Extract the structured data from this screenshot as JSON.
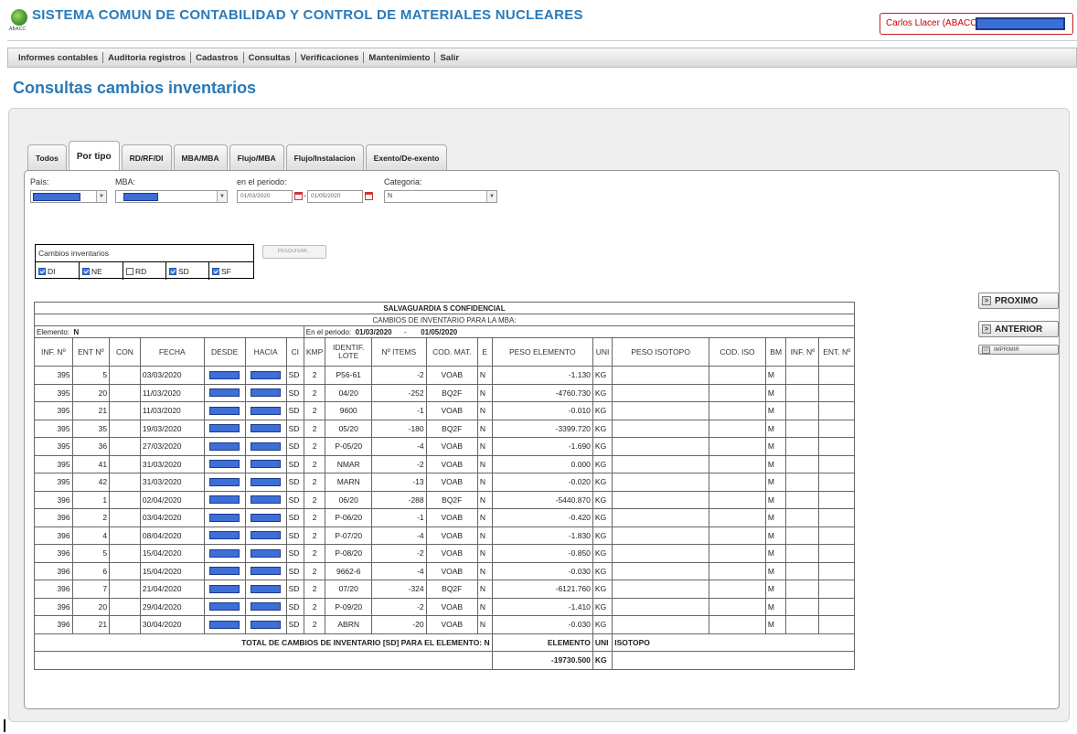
{
  "app": {
    "title": "SISTEMA COMUN DE CONTABILIDAD Y CONTROL DE MATERIALES NUCLEARES",
    "logo_text": "ABACC",
    "user_label": "Carlos Llacer (ABACC-"
  },
  "nav": {
    "items": [
      "Informes contables",
      "Auditoria registros",
      "Cadastros",
      "Consultas",
      "Verificaciones",
      "Mantenimiento",
      "Salir"
    ]
  },
  "page_title": "Consultas cambios inventarios",
  "tabs": [
    "Todos",
    "Por tipo",
    "RD/RF/DI",
    "MBA/MBA",
    "Flujo/MBA",
    "Flujo/Instalacion",
    "Exento/De-exento"
  ],
  "active_tab": "Por tipo",
  "filters": {
    "pais_label": "País:",
    "mba_label": "MBA:",
    "periodo_label": "en el periodo:",
    "categoria_label": "Categoria:",
    "date_from": "01/03/2020",
    "date_to": "01/05/2020",
    "categoria_value": "N",
    "pesquisar_label": "PESQUISAR..."
  },
  "cambios": {
    "title": "Cambios inventarios",
    "options": [
      {
        "label": "DI",
        "checked": true
      },
      {
        "label": "NE",
        "checked": true
      },
      {
        "label": "RD",
        "checked": false
      },
      {
        "label": "SD",
        "checked": true
      },
      {
        "label": "SF",
        "checked": true
      }
    ]
  },
  "buttons": {
    "proximo": "PROXIMO",
    "anterior": "ANTERIOR",
    "imprimir": "IMPRIMIR"
  },
  "report": {
    "title": "SALVAGUARDIA S CONFIDENCIAL",
    "subtitle": "CAMBIOS DE INVENTARIO PARA LA MBA:",
    "elemento_label": "Elemento:",
    "elemento_value": "N",
    "periodo_label": "En el periodo:",
    "periodo_from": "01/03/2020",
    "periodo_sep": "-",
    "periodo_to": "01/05/2020",
    "columns": [
      "INF. Nº",
      "ENT Nº",
      "CON",
      "FECHA",
      "DESDE",
      "HACIA",
      "CI",
      "KMP",
      "IDENTIF. LOTE",
      "Nº ITEMS",
      "COD. MAT.",
      "E",
      "PESO ELEMENTO",
      "UNI",
      "PESO ISOTOPO",
      "COD. ISO",
      "BM",
      "INF. Nº",
      "ENT. Nº"
    ],
    "rows": [
      {
        "inf": "395",
        "ent": "5",
        "fecha": "03/03/2020",
        "ci": "SD",
        "kmp": "2",
        "lote": "P56-61",
        "items": "-2",
        "codmat": "VOAB",
        "e": "N",
        "peso": "-1.130",
        "uni": "KG",
        "bm": "M"
      },
      {
        "inf": "395",
        "ent": "20",
        "fecha": "11/03/2020",
        "ci": "SD",
        "kmp": "2",
        "lote": "04/20",
        "items": "-252",
        "codmat": "BQ2F",
        "e": "N",
        "peso": "-4760.730",
        "uni": "KG",
        "bm": "M"
      },
      {
        "inf": "395",
        "ent": "21",
        "fecha": "11/03/2020",
        "ci": "SD",
        "kmp": "2",
        "lote": "9600",
        "items": "-1",
        "codmat": "VOAB",
        "e": "N",
        "peso": "-0.010",
        "uni": "KG",
        "bm": "M"
      },
      {
        "inf": "395",
        "ent": "35",
        "fecha": "19/03/2020",
        "ci": "SD",
        "kmp": "2",
        "lote": "05/20",
        "items": "-180",
        "codmat": "BQ2F",
        "e": "N",
        "peso": "-3399.720",
        "uni": "KG",
        "bm": "M"
      },
      {
        "inf": "395",
        "ent": "36",
        "fecha": "27/03/2020",
        "ci": "SD",
        "kmp": "2",
        "lote": "P-05/20",
        "items": "-4",
        "codmat": "VOAB",
        "e": "N",
        "peso": "-1.690",
        "uni": "KG",
        "bm": "M"
      },
      {
        "inf": "395",
        "ent": "41",
        "fecha": "31/03/2020",
        "ci": "SD",
        "kmp": "2",
        "lote": "NMAR",
        "items": "-2",
        "codmat": "VOAB",
        "e": "N",
        "peso": "0.000",
        "uni": "KG",
        "bm": "M"
      },
      {
        "inf": "395",
        "ent": "42",
        "fecha": "31/03/2020",
        "ci": "SD",
        "kmp": "2",
        "lote": "MARN",
        "items": "-13",
        "codmat": "VOAB",
        "e": "N",
        "peso": "-0.020",
        "uni": "KG",
        "bm": "M"
      },
      {
        "inf": "396",
        "ent": "1",
        "fecha": "02/04/2020",
        "ci": "SD",
        "kmp": "2",
        "lote": "06/20",
        "items": "-288",
        "codmat": "BQ2F",
        "e": "N",
        "peso": "-5440.870",
        "uni": "KG",
        "bm": "M"
      },
      {
        "inf": "396",
        "ent": "2",
        "fecha": "03/04/2020",
        "ci": "SD",
        "kmp": "2",
        "lote": "P-06/20",
        "items": "-1",
        "codmat": "VOAB",
        "e": "N",
        "peso": "-0.420",
        "uni": "KG",
        "bm": "M"
      },
      {
        "inf": "396",
        "ent": "4",
        "fecha": "08/04/2020",
        "ci": "SD",
        "kmp": "2",
        "lote": "P-07/20",
        "items": "-4",
        "codmat": "VOAB",
        "e": "N",
        "peso": "-1.830",
        "uni": "KG",
        "bm": "M"
      },
      {
        "inf": "396",
        "ent": "5",
        "fecha": "15/04/2020",
        "ci": "SD",
        "kmp": "2",
        "lote": "P-08/20",
        "items": "-2",
        "codmat": "VOAB",
        "e": "N",
        "peso": "-0.850",
        "uni": "KG",
        "bm": "M"
      },
      {
        "inf": "396",
        "ent": "6",
        "fecha": "15/04/2020",
        "ci": "SD",
        "kmp": "2",
        "lote": "9662-6",
        "items": "-4",
        "codmat": "VOAB",
        "e": "N",
        "peso": "-0.030",
        "uni": "KG",
        "bm": "M"
      },
      {
        "inf": "396",
        "ent": "7",
        "fecha": "21/04/2020",
        "ci": "SD",
        "kmp": "2",
        "lote": "07/20",
        "items": "-324",
        "codmat": "BQ2F",
        "e": "N",
        "peso": "-6121.760",
        "uni": "KG",
        "bm": "M"
      },
      {
        "inf": "396",
        "ent": "20",
        "fecha": "29/04/2020",
        "ci": "SD",
        "kmp": "2",
        "lote": "P-09/20",
        "items": "-2",
        "codmat": "VOAB",
        "e": "N",
        "peso": "-1.410",
        "uni": "KG",
        "bm": "M"
      },
      {
        "inf": "396",
        "ent": "21",
        "fecha": "30/04/2020",
        "ci": "SD",
        "kmp": "2",
        "lote": "ABRN",
        "items": "-20",
        "codmat": "VOAB",
        "e": "N",
        "peso": "-0.030",
        "uni": "KG",
        "bm": "M"
      }
    ],
    "total_label": "TOTAL DE CAMBIOS DE INVENTARIO [SD] PARA EL ELEMENTO: N",
    "total_elemento_label": "ELEMENTO",
    "total_uni_label": "UNI",
    "total_isotopo_label": "ISOTOPO",
    "total_value": "-19730.500",
    "total_uni": "KG"
  },
  "colors": {
    "accent": "#2a7ab8",
    "redaction": "#3e6fd8",
    "user_text": "#cc0000"
  }
}
